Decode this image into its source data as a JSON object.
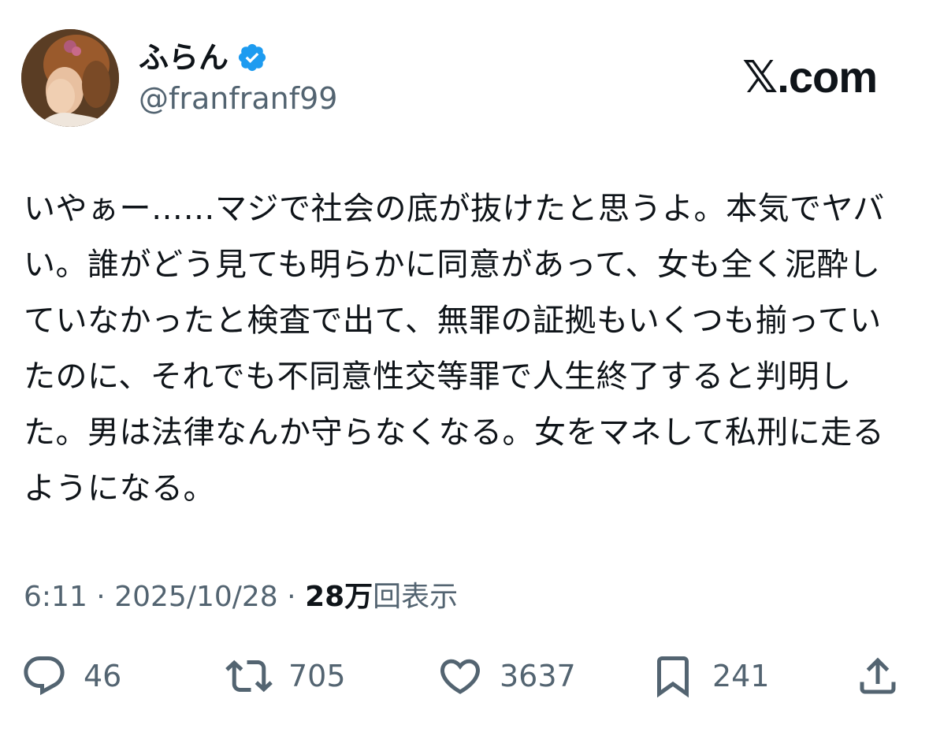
{
  "author": {
    "display_name": "ふらん",
    "handle": "@franfranf99",
    "verified": true,
    "verified_color": "#1d9bf0"
  },
  "brand": "𝕏.com",
  "tweet": {
    "text": "いやぁー……マジで社会の底が抜けたと思うよ。本気でヤバい。誰がどう見ても明らかに同意があって、女も全く泥酔していなかったと検査で出て、無罪の証拠もいくつも揃っていたのに、それでも不同意性交等罪で人生終了すると判明した。男は法律なんか守らなくなる。女をマネして私刑に走るようになる。"
  },
  "meta": {
    "time": "6:11",
    "separator": "·",
    "date": "2025/10/28",
    "views_count": "28万",
    "views_label": "回表示"
  },
  "actions": {
    "replies": "46",
    "reposts": "705",
    "likes": "3637",
    "bookmarks": "241"
  },
  "colors": {
    "text": "#0f1419",
    "secondary": "#536471"
  }
}
